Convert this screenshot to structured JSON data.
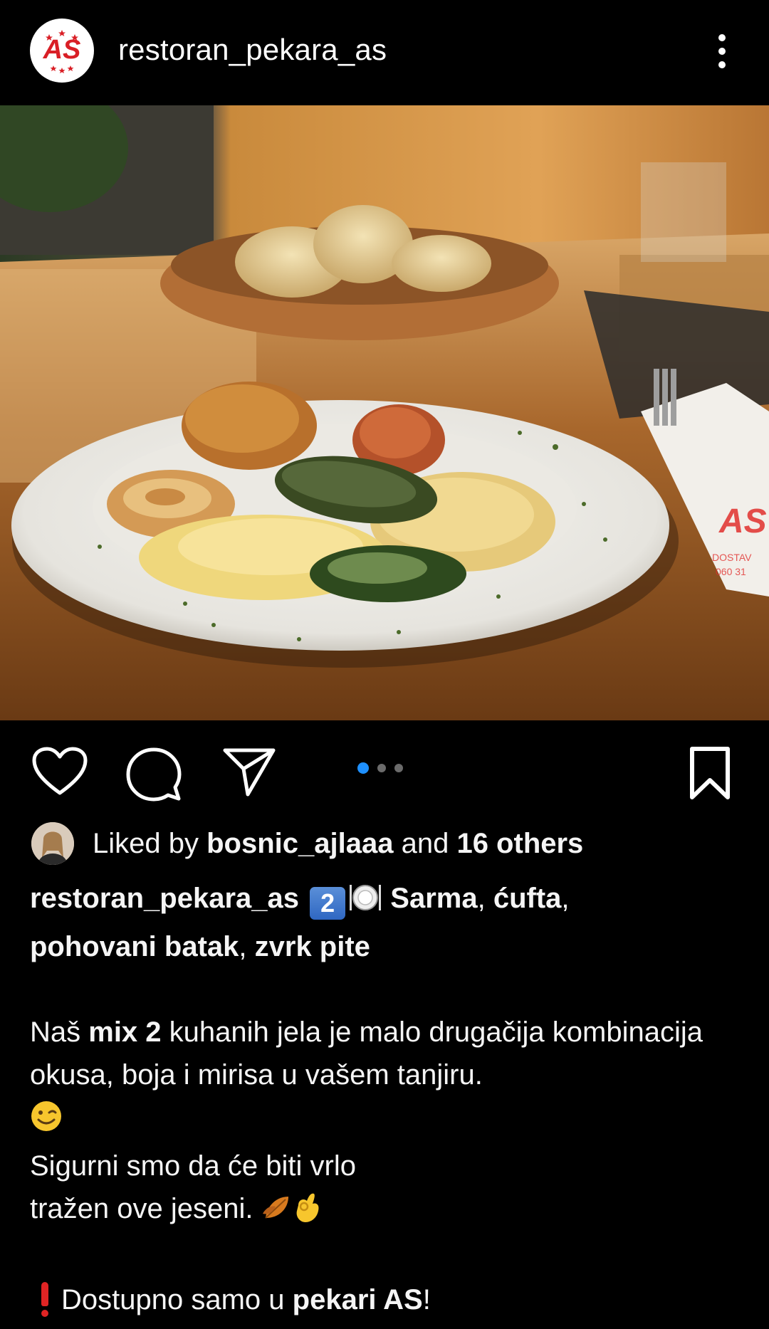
{
  "header": {
    "username": "restoran_pekara_as",
    "logo_text": "AS"
  },
  "post": {
    "carousel": {
      "count": 3,
      "active_index": 0
    }
  },
  "likes": {
    "prefix": "Liked by ",
    "user": "bosnic_ajlaaa",
    "middle": " and ",
    "others": "16 others"
  },
  "caption": {
    "username": "restoran_pekara_as",
    "badge_number": "2",
    "title_1": "Sarma",
    "sep_1": ", ",
    "title_2": "ćufta",
    "sep_2": ",",
    "title_3": "pohovani batak",
    "sep_3": ", ",
    "title_4": "zvrk pite",
    "body_1a": "Naš ",
    "body_1b": "mix 2",
    "body_1c": " kuhanih jela je malo drugačija kombinacija okusa, boja i mirisa u vašem tanjiru.",
    "body_2a": "Sigurni smo da će biti vrlo",
    "body_2b": "tražen ove jeseni.",
    "body_3a": "Dostupno samo u ",
    "body_3b": "pekari AS",
    "body_3c": "!"
  },
  "colors": {
    "background": "#000000",
    "text": "#f5f5f5",
    "active_dot": "#1e90ff",
    "brand_red": "#e02424"
  }
}
